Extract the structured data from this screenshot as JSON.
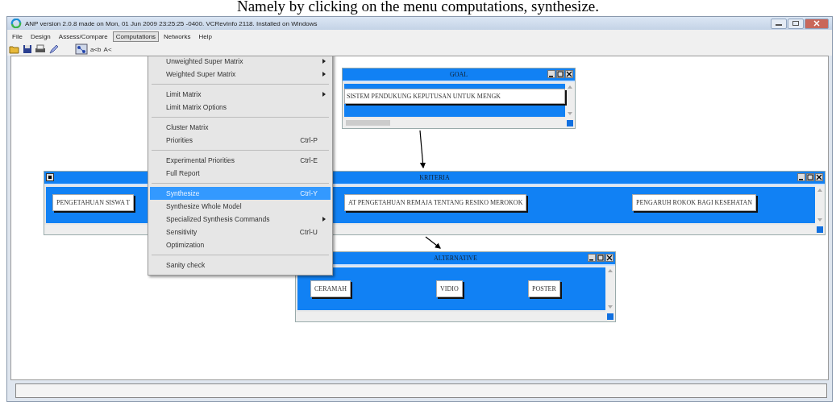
{
  "caption": "Namely by clicking on the menu computations, synthesize.",
  "window": {
    "title": "ANP version 2.0.8 made on Mon, 01 Jun 2009 23:25:25 -0400.  VCRevInfo 2118.  Installed on Windows"
  },
  "menubar": [
    {
      "label": "File",
      "selected": false
    },
    {
      "label": "Design",
      "selected": false
    },
    {
      "label": "Assess/Compare",
      "selected": false
    },
    {
      "label": "Computations",
      "selected": true
    },
    {
      "label": "Networks",
      "selected": false
    },
    {
      "label": "Help",
      "selected": false
    }
  ],
  "toolbar": {
    "texts": [
      "a<b",
      "A<"
    ]
  },
  "menu": {
    "items": [
      {
        "kind": "item",
        "label": "Unweighted Super Matrix",
        "submenu": true,
        "selected": false
      },
      {
        "kind": "item",
        "label": "Weighted Super Matrix",
        "submenu": true,
        "selected": false
      },
      {
        "kind": "separator"
      },
      {
        "kind": "item",
        "label": "Limit Matrix",
        "submenu": true,
        "selected": false
      },
      {
        "kind": "item",
        "label": "Limit Matrix Options",
        "submenu": false,
        "selected": false
      },
      {
        "kind": "separator"
      },
      {
        "kind": "item",
        "label": "Cluster Matrix",
        "submenu": false,
        "selected": false
      },
      {
        "kind": "item",
        "label": "Priorities",
        "shortcut": "Ctrl-P",
        "submenu": false,
        "selected": false
      },
      {
        "kind": "separator"
      },
      {
        "kind": "item",
        "label": "Experimental Priorities",
        "shortcut": "Ctrl-E",
        "submenu": false,
        "selected": false
      },
      {
        "kind": "item",
        "label": "Full Report",
        "submenu": false,
        "selected": false
      },
      {
        "kind": "separator"
      },
      {
        "kind": "item",
        "label": "Synthesize",
        "shortcut": "Ctrl-Y",
        "submenu": false,
        "selected": true
      },
      {
        "kind": "item",
        "label": "Synthesize Whole Model",
        "submenu": false,
        "selected": false
      },
      {
        "kind": "item",
        "label": "Specialized Synthesis Commands",
        "submenu": true,
        "selected": false
      },
      {
        "kind": "item",
        "label": "Sensitivity",
        "shortcut": "Ctrl-U",
        "submenu": false,
        "selected": false
      },
      {
        "kind": "item",
        "label": "Optimization",
        "submenu": false,
        "selected": false
      },
      {
        "kind": "separator"
      },
      {
        "kind": "item",
        "label": "Sanity check",
        "submenu": false,
        "selected": false
      }
    ]
  },
  "clusters": [
    {
      "title": "GOAL",
      "nodes": [
        "SISTEM PENDUKUNG KEPUTUSAN UNTUK MENGK"
      ]
    },
    {
      "title": "KRITERIA",
      "nodes": [
        "PENGETAHUAN SISWA T",
        "AT PENGETAHUAN REMAJA TENTANG RESIKO MEROKOK",
        "PENGARUH ROKOK BAGI KESEHATAN"
      ]
    },
    {
      "title": "ALTERNATIVE",
      "nodes": [
        "CERAMAH",
        "VIDIO",
        "POSTER"
      ]
    }
  ]
}
